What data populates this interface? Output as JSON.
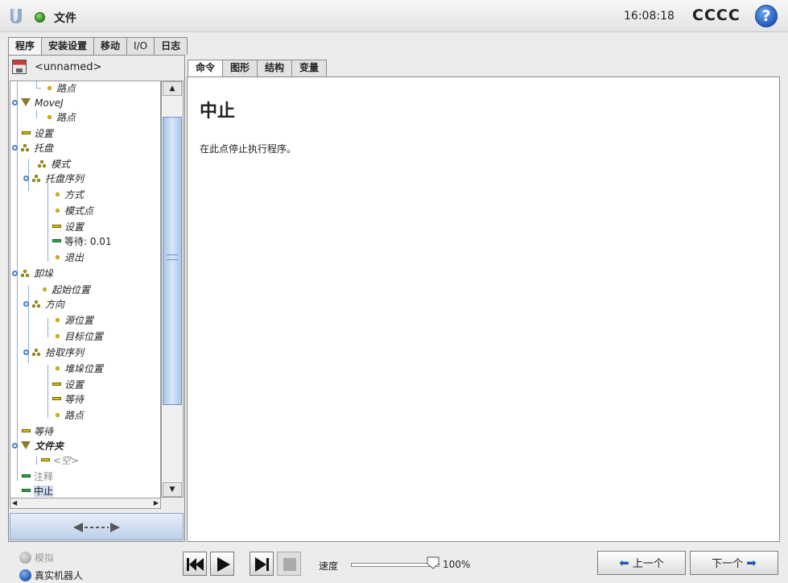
{
  "titlebar": {
    "file_menu": "文件",
    "time": "16:08:18",
    "robot_name": "CCCC",
    "help": "?"
  },
  "main_tabs": [
    "程序",
    "安装设置",
    "移动",
    "I/O",
    "日志"
  ],
  "program": {
    "file_name": "<unnamed>"
  },
  "tree": [
    {
      "label": "路点",
      "icon": "waypoint-icon"
    },
    {
      "label": "MoveJ",
      "icon": "move-icon"
    },
    {
      "label": "路点",
      "icon": "waypoint-icon"
    },
    {
      "label": "设置",
      "icon": "set-icon"
    },
    {
      "label": "托盘",
      "icon": "pallet-icon"
    },
    {
      "label": "模式",
      "icon": "pallet-icon"
    },
    {
      "label": "托盘序列",
      "icon": "pallet-icon"
    },
    {
      "label": "方式",
      "icon": "waypoint-icon"
    },
    {
      "label": "模式点",
      "icon": "waypoint-icon"
    },
    {
      "label": "设置",
      "icon": "set-icon"
    },
    {
      "label": "等待: 0.01",
      "icon": "wait-icon"
    },
    {
      "label": "退出",
      "icon": "waypoint-icon"
    },
    {
      "label": "卸垛",
      "icon": "pallet-icon"
    },
    {
      "label": "起始位置",
      "icon": "waypoint-icon"
    },
    {
      "label": "方向",
      "icon": "pallet-icon"
    },
    {
      "label": "源位置",
      "icon": "waypoint-icon"
    },
    {
      "label": "目标位置",
      "icon": "waypoint-icon"
    },
    {
      "label": "拾取序列",
      "icon": "pallet-icon"
    },
    {
      "label": "堆垛位置",
      "icon": "waypoint-icon"
    },
    {
      "label": "设置",
      "icon": "set-icon"
    },
    {
      "label": "等待",
      "icon": "set-icon"
    },
    {
      "label": "路点",
      "icon": "waypoint-icon"
    },
    {
      "label": "等待",
      "icon": "set-icon"
    },
    {
      "label": "文件夹",
      "icon": "folder-icon"
    },
    {
      "label": "<空>",
      "icon": "set-icon"
    },
    {
      "label": "注释",
      "icon": "comment-icon"
    },
    {
      "label": "中止",
      "icon": "halt-icon"
    }
  ],
  "sub_tabs": [
    "命令",
    "图形",
    "结构",
    "变量"
  ],
  "command": {
    "title": "中止",
    "description": "在此点停止执行程序。"
  },
  "bottom": {
    "sim_label": "模拟",
    "real_label": "真实机器人",
    "speed_label": "速度",
    "speed_value": "100%",
    "speed_fraction": 1.0,
    "prev_label": "上一个",
    "next_label": "下一个"
  }
}
